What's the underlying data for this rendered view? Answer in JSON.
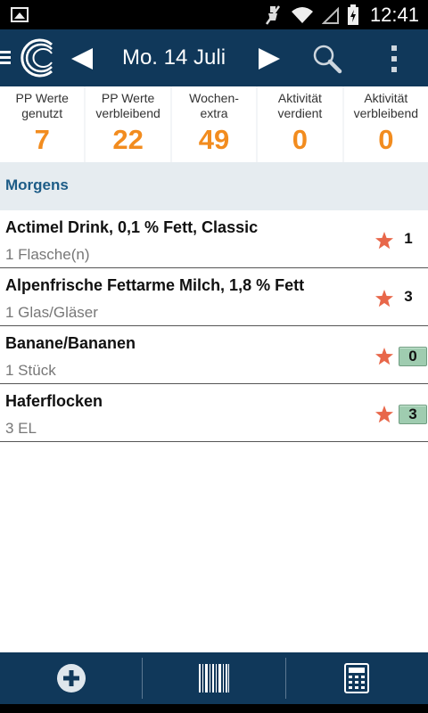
{
  "status_bar": {
    "time": "12:41"
  },
  "app_bar": {
    "date": "Mo. 14 Juli"
  },
  "stats": [
    {
      "label": "PP Werte\ngenutzt",
      "value": "7"
    },
    {
      "label": "PP Werte\nverbleibend",
      "value": "22"
    },
    {
      "label": "Wochen-\nextra",
      "value": "49"
    },
    {
      "label": "Aktivität\nverdient",
      "value": "0"
    },
    {
      "label": "Aktivität\nverbleibend",
      "value": "0"
    }
  ],
  "section": {
    "title": "Morgens"
  },
  "items": [
    {
      "name": "Actimel Drink, 0,1 % Fett, Classic",
      "amount": "1 Flasche(n)",
      "points": "1"
    },
    {
      "name": "Alpenfrische Fettarme Milch, 1,8 % Fett",
      "amount": "1 Glas/Gläser",
      "points": "3"
    },
    {
      "name": "Banane/Bananen",
      "amount": "1 Stück",
      "points": "0"
    },
    {
      "name": "Haferflocken",
      "amount": "3 EL",
      "points": "3"
    }
  ],
  "colors": {
    "app_bar": "#10385a",
    "stat_value": "#f28c1f",
    "section_title": "#1d5c87",
    "star": "#e8674a",
    "points_badge": "#9fccb0"
  },
  "icons": [
    "image-icon",
    "mute-icon",
    "wifi-icon",
    "signal-icon",
    "battery-icon",
    "menu-drawer-icon",
    "logo",
    "prev-arrow-icon",
    "next-arrow-icon",
    "search-icon",
    "overflow-menu-icon",
    "star-icon",
    "add-icon",
    "barcode-icon",
    "calculator-icon"
  ]
}
